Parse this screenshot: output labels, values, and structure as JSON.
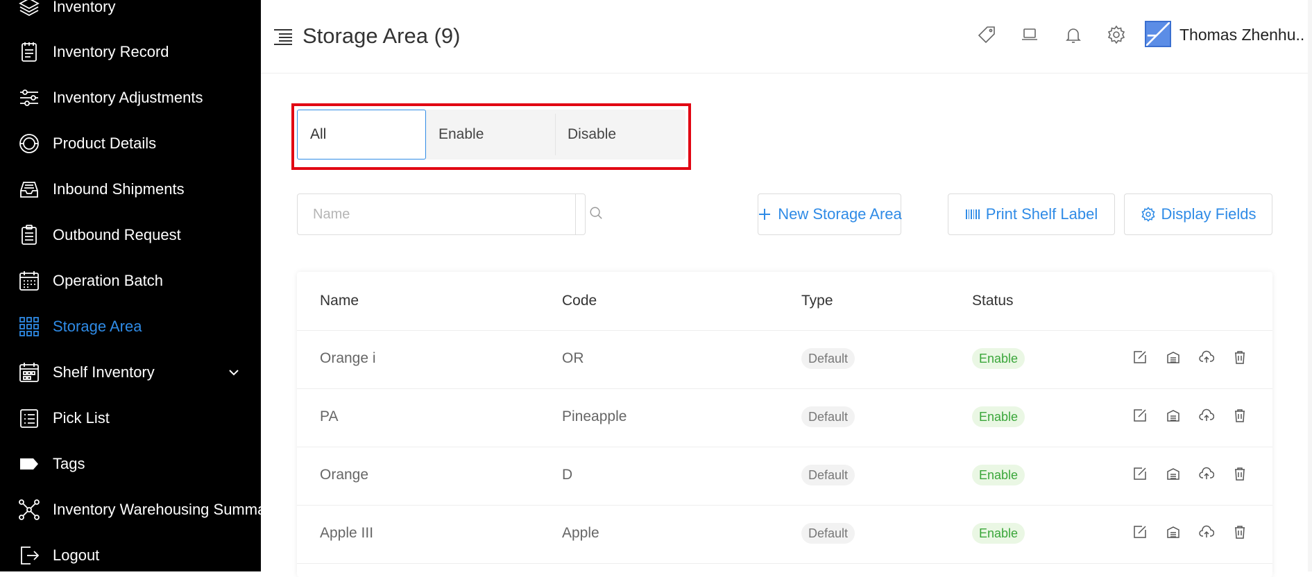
{
  "sidebar": {
    "items": [
      {
        "label": "Inventory",
        "icon": "layers-icon",
        "active": false
      },
      {
        "label": "Inventory Record",
        "icon": "record-book-icon",
        "active": false
      },
      {
        "label": "Inventory Adjustments",
        "icon": "sliders-icon",
        "active": false
      },
      {
        "label": "Product Details",
        "icon": "target-icon",
        "active": false
      },
      {
        "label": "Inbound Shipments",
        "icon": "inbox-tray-icon",
        "active": false
      },
      {
        "label": "Outbound Request",
        "icon": "clipboard-list-icon",
        "active": false
      },
      {
        "label": "Operation Batch",
        "icon": "calendar-grid-icon",
        "active": false
      },
      {
        "label": "Storage Area",
        "icon": "grid-icon",
        "active": true
      },
      {
        "label": "Shelf Inventory",
        "icon": "calendar-shelf-icon",
        "active": false,
        "expandable": true
      },
      {
        "label": "Pick List",
        "icon": "checklist-icon",
        "active": false
      },
      {
        "label": "Tags",
        "icon": "tag-icon",
        "active": false
      },
      {
        "label": "Inventory Warehousing Summar",
        "icon": "network-icon",
        "active": false
      },
      {
        "label": "Logout",
        "icon": "logout-icon",
        "active": false
      }
    ]
  },
  "header": {
    "title": "Storage Area (9)",
    "user_name": "Thomas Zhenhu..",
    "icons": [
      "tag-outline-icon",
      "laptop-icon",
      "bell-icon",
      "gear-icon"
    ]
  },
  "filter": {
    "tabs": [
      "All",
      "Enable",
      "Disable"
    ],
    "active": "All"
  },
  "search": {
    "placeholder": "Name",
    "value": ""
  },
  "toolbar": {
    "new_label": "New Storage Area",
    "print_label": "Print Shelf Label",
    "display_label": "Display Fields"
  },
  "table": {
    "headers": [
      "Name",
      "Code",
      "Type",
      "Status"
    ],
    "rows": [
      {
        "name": "Orange i",
        "code": "OR",
        "type": "Default",
        "status": "Enable"
      },
      {
        "name": "PA",
        "code": "Pineapple",
        "type": "Default",
        "status": "Enable"
      },
      {
        "name": "Orange",
        "code": "D",
        "type": "Default",
        "status": "Enable"
      },
      {
        "name": "Apple III",
        "code": "Apple",
        "type": "Default",
        "status": "Enable"
      }
    ]
  },
  "colors": {
    "accent": "#2f8be6",
    "highlight": "#e10613",
    "status_green": "#3aa63a",
    "sidebar_bg": "#000000"
  }
}
